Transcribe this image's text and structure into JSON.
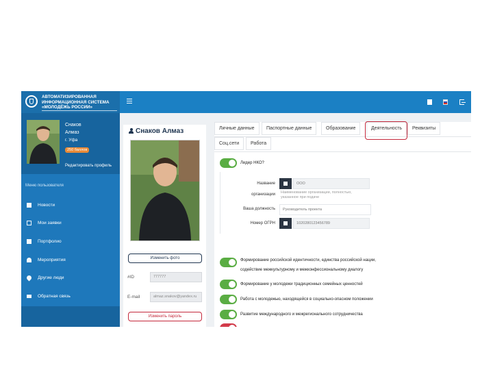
{
  "header": {
    "logo_text": "АВТОМАТИЗИРОВАННАЯ ИНФОРМАЦИОННАЯ СИСТЕМА «МОЛОДЁЖЬ РОССИИ»",
    "icons": [
      "menu-icon",
      "document-icon",
      "language-flag-icon",
      "logout-icon"
    ],
    "colors": {
      "topbar": "#1b80c4",
      "sidebar": "#1e78bb",
      "accent_red": "#c4283b",
      "toggle_green": "#5aad43"
    }
  },
  "sidebar": {
    "user_first": "Снаков",
    "user_second": "Алмаз",
    "city": "г. Уфа",
    "points_badge": "250 баллов",
    "edit_profile": "Редактировать профиль",
    "section_heading": "Меню пользователя",
    "items": [
      {
        "label": "Новости",
        "icon": "megaphone-icon"
      },
      {
        "label": "Мои заявки",
        "icon": "chat-icon"
      },
      {
        "label": "Портфолио",
        "icon": "folder-icon"
      },
      {
        "label": "Мероприятия",
        "icon": "group-icon"
      },
      {
        "label": "Другие люди",
        "icon": "location-icon"
      },
      {
        "label": "Обратная связь",
        "icon": "mail-icon"
      }
    ]
  },
  "profile": {
    "name": "Снаков Алмаз",
    "change_photo": "Изменить фото",
    "id_label": "#ID",
    "id_value": "777777",
    "email_label": "E-mail",
    "email_value": "almaz.snakov@yandex.ru",
    "change_password": "Изменить пароль"
  },
  "tabs": {
    "row1": [
      "Личные данные",
      "Паспортные данные",
      "Образование",
      "Деятельность",
      "Реквизиты"
    ],
    "row2": [
      "Соц.сети",
      "Работа"
    ],
    "active": "Деятельность"
  },
  "activity": {
    "nko_toggle": "Лидер НКО?",
    "org_name_label": "Название",
    "org_name_label2": "организации",
    "org_name_value": "ООО",
    "org_hint": "Наименование организации, полностью, указанное при подаче",
    "position_label": "Ваша должность",
    "position_value": "Руководитель проекта",
    "ogrn_label": "Номер ОГРН",
    "ogrn_value": "1020280123456789",
    "directions": [
      "Формирование российской идентичности, единства российской нации,",
      "содействие межкультурному и межконфессиональному диалогу",
      "Формирование у молодежи традиционных семейных ценностей",
      "Работа с молодежью, находящейся в социально-опасном положении",
      "Развитие международного и межрегионального сотрудничества"
    ]
  }
}
